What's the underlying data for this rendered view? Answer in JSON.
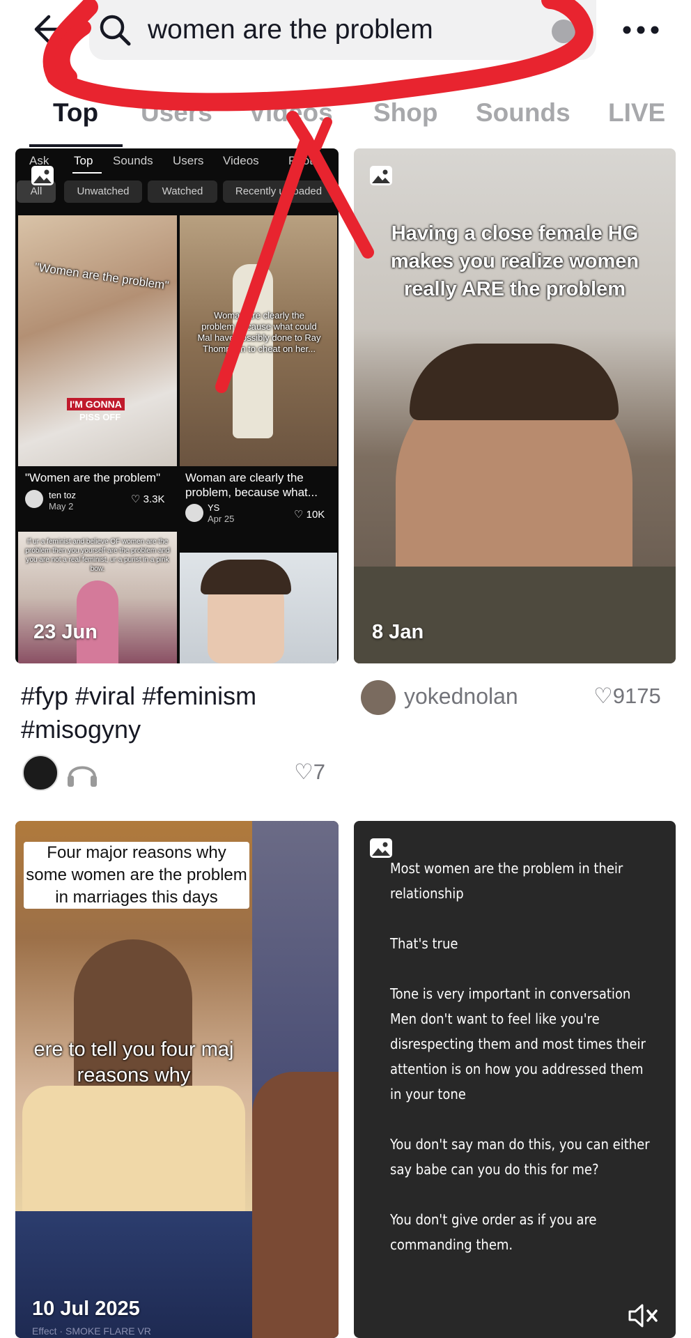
{
  "search": {
    "query": "women are the problem"
  },
  "tabs": [
    {
      "label": "Top"
    },
    {
      "label": "Users"
    },
    {
      "label": "Videos"
    },
    {
      "label": "Shop"
    },
    {
      "label": "Sounds"
    },
    {
      "label": "LIVE"
    }
  ],
  "results": [
    {
      "date": "23 Jun",
      "caption": "#fyp #viral #feminism #misogyny",
      "likes": "7",
      "inner_screenshot": {
        "tabs": [
          "Ask",
          "Top",
          "Sounds",
          "Users",
          "Videos",
          "Photo"
        ],
        "chips": [
          "All",
          "Unwatched",
          "Watched",
          "Recently uploaded"
        ],
        "videos": [
          {
            "overlay_text": "\"Women are the problem\"",
            "sticker_1": "I'M GONNA",
            "sticker_2": "PISS OFF",
            "caption": "\"Women are the problem\"",
            "author": "ten toz",
            "date": "May 2",
            "likes": "3.3K"
          },
          {
            "overlay_text": "Woman are clearly the problem because what could Mal have possibly done to Ray Thompson to cheat on her...",
            "caption": "Woman are clearly the problem, because what...",
            "author": "YS",
            "date": "Apr 25",
            "likes": "10K"
          },
          {
            "overlay_text": "If ur a feminist and believe OF women are the problem then you yourself are the problem and you are not a real feminist, ur a purist in a pink bow."
          },
          {
            "overlay_text": ""
          }
        ]
      }
    },
    {
      "date": "8 Jan",
      "overlay_text": "Having a close female HG makes you realize women really ARE the problem",
      "author": "yokednolan",
      "likes": "9175"
    },
    {
      "date": "10 Jul 2025",
      "overlay_text_top": "Four major reasons why some women are the problem in marriages this days",
      "overlay_text_mid": "ere to tell you four maj reasons why",
      "effect_label": "Effect · SMOKE FLARE VR"
    },
    {
      "text_blocks": [
        "Most women are the problem in their relationship",
        "That's true",
        "Tone is very important in conversation Men don't want to feel like you're disrespecting them and most times their attention is on how you addressed them in your tone",
        "You don't say man do this, you can either say babe can you do this for me?",
        "You don't give order as if you are commanding them."
      ]
    }
  ],
  "colors": {
    "annotation_red": "#e8242f",
    "text_primary": "#161823",
    "text_secondary": "#73747a"
  }
}
